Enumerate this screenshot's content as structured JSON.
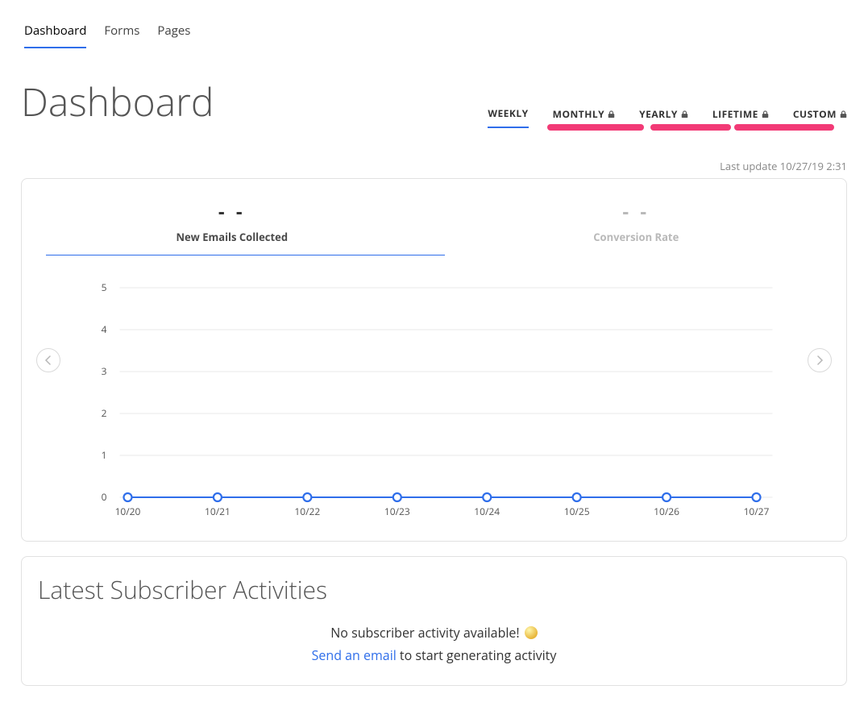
{
  "nav": {
    "items": [
      "Dashboard",
      "Forms",
      "Pages"
    ],
    "activeIndex": 0
  },
  "pageTitle": "Dashboard",
  "rangeTabs": [
    {
      "label": "WEEKLY",
      "locked": false,
      "active": true
    },
    {
      "label": "MONTHLY",
      "locked": true,
      "active": false
    },
    {
      "label": "YEARLY",
      "locked": true,
      "active": false
    },
    {
      "label": "LIFETIME",
      "locked": true,
      "active": false
    },
    {
      "label": "CUSTOM",
      "locked": true,
      "active": false
    }
  ],
  "lastUpdate": "Last update 10/27/19 2:31",
  "metricTabs": [
    {
      "value": "- -",
      "label": "New Emails Collected",
      "active": true
    },
    {
      "value": "- -",
      "label": "Conversion Rate",
      "active": false
    }
  ],
  "chart_data": {
    "type": "line",
    "categories": [
      "10/20",
      "10/21",
      "10/22",
      "10/23",
      "10/24",
      "10/25",
      "10/26",
      "10/27"
    ],
    "values": [
      0,
      0,
      0,
      0,
      0,
      0,
      0,
      0
    ],
    "y_ticks": [
      0,
      1,
      2,
      3,
      4,
      5
    ],
    "ylim": [
      0,
      5
    ],
    "title": "",
    "xlabel": "",
    "ylabel": ""
  },
  "activities": {
    "heading": "Latest Subscriber Activities",
    "emptyLine1": "No subscriber activity available!",
    "linkText": "Send an email",
    "emptySuffix": " to start generating activity"
  }
}
